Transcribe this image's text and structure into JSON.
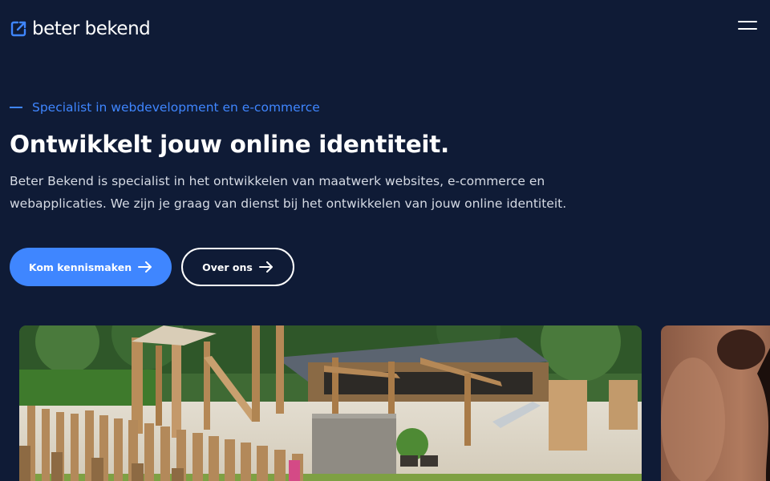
{
  "header": {
    "logo_text": "beter bekend",
    "logo_icon": "external-link-icon",
    "menu_icon": "hamburger-menu-icon"
  },
  "hero": {
    "eyebrow": "Specialist in webdevelopment en e-commerce",
    "title": "Ontwikkelt jouw online identiteit.",
    "description": "Beter Bekend is specialist in het ontwikkelen van maatwerk websites, e-commerce en webapplicaties. We zijn je graag van dienst bij het ontwikkelen van jouw online identiteit.",
    "primary_button": "Kom kennismaken",
    "secondary_button": "Over ons"
  },
  "colors": {
    "background": "#0f1b36",
    "accent": "#3f86ff",
    "text": "#ffffff"
  }
}
